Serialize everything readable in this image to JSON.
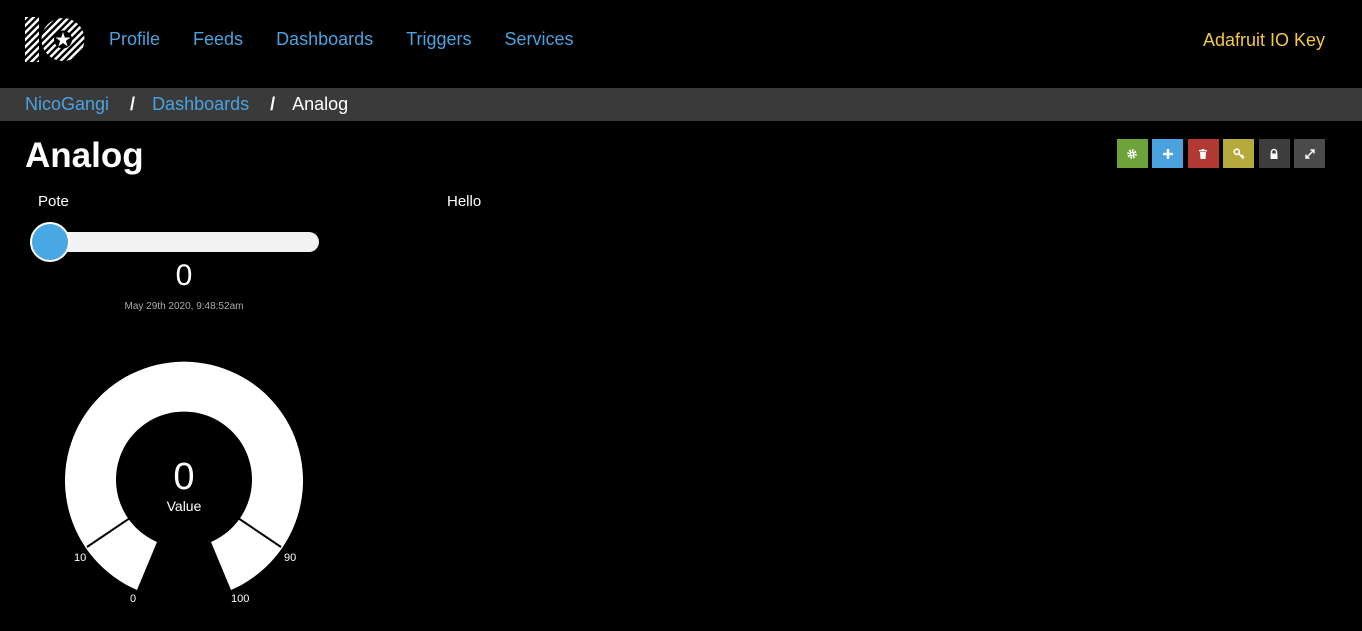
{
  "nav": {
    "items": [
      "Profile",
      "Feeds",
      "Dashboards",
      "Triggers",
      "Services"
    ],
    "key_link": "Adafruit IO Key"
  },
  "breadcrumb": {
    "user": "NicoGangi",
    "section": "Dashboards",
    "current": "Analog",
    "separator": "/"
  },
  "page": {
    "title": "Analog"
  },
  "toolbar": {
    "icons": [
      "gear-icon",
      "plus-icon",
      "trash-icon",
      "key-icon",
      "lock-icon",
      "expand-icon"
    ],
    "colors": {
      "settings": "#6ea33b",
      "add": "#4aa3df",
      "delete": "#b33a34",
      "key": "#b5a83c",
      "lock": "#3e3e3e",
      "expand": "#4b4b4b"
    }
  },
  "blocks": {
    "slider": {
      "title": "Pote",
      "value": "0",
      "timestamp": "May 29th 2020, 9:48:52am",
      "min": 0,
      "max": 100,
      "level": 0
    },
    "text": {
      "title": "Hello"
    },
    "gauge": {
      "value": "0",
      "label": "Value",
      "ticks": {
        "t0": "0",
        "t10": "10",
        "t90": "90",
        "t100": "100"
      },
      "min": 0,
      "max": 100
    }
  },
  "colors": {
    "link": "#4aa3df",
    "accent_key": "#f5c842",
    "slider_thumb": "#49a7e3"
  }
}
